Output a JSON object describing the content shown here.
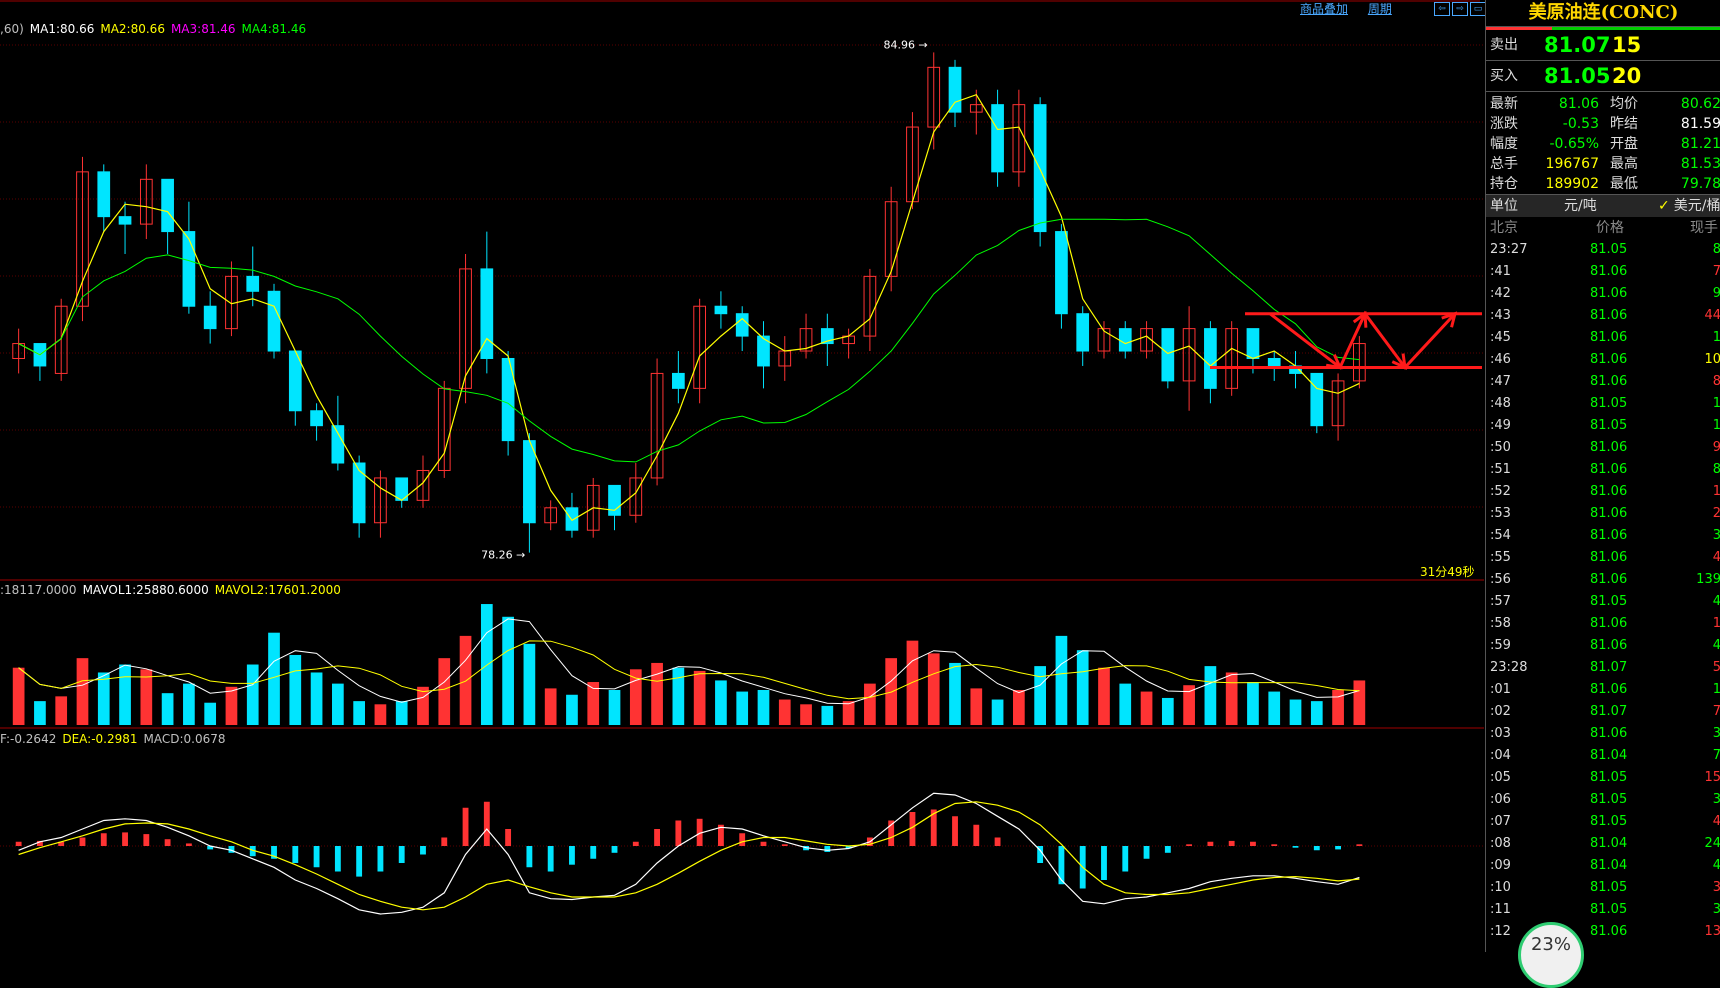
{
  "top_links": {
    "overlay": "商品叠加",
    "period": "周期"
  },
  "legend_main": {
    "prefix": ",60)",
    "ma1": "MA1:80.66",
    "ma2": "MA2:80.66",
    "ma3": "MA3:81.46",
    "ma4": "MA4:81.46"
  },
  "legend_vol": {
    "prefix": ":18117.0000",
    "mavol1": "MAVOL1:25880.6000",
    "mavol2": "MAVOL2:17601.2000"
  },
  "legend_macd": {
    "prefix": "F:-0.2642",
    "dea": "DEA:-0.2981",
    "macd": "MACD:0.0678"
  },
  "countdown": "31分49秒",
  "colors": {
    "up": "#ff3333",
    "down": "#00e5ff",
    "ma1": "#ffffff",
    "ma2": "#ffff00",
    "ma3": "#ff00ff",
    "ma4": "#00ff00",
    "annotation": "#ff1a1a",
    "grid": "#5a0000"
  },
  "chart_data": {
    "type": "candlestick",
    "price_high_label": "84.96",
    "price_low_label": "78.26",
    "ylim": [
      78.0,
      85.3
    ],
    "candles": [
      [
        80.9,
        81.3,
        80.7,
        81.1
      ],
      [
        81.1,
        81.0,
        80.6,
        80.8
      ],
      [
        80.7,
        81.7,
        80.6,
        81.6
      ],
      [
        81.6,
        83.6,
        81.4,
        83.4
      ],
      [
        83.4,
        83.5,
        82.6,
        82.8
      ],
      [
        82.8,
        83.0,
        82.3,
        82.7
      ],
      [
        82.7,
        83.5,
        82.5,
        83.3
      ],
      [
        83.3,
        82.8,
        82.3,
        82.6
      ],
      [
        82.6,
        83.0,
        81.5,
        81.6
      ],
      [
        81.6,
        81.8,
        81.1,
        81.3
      ],
      [
        81.3,
        82.2,
        81.2,
        82.0
      ],
      [
        82.0,
        82.4,
        81.6,
        81.8
      ],
      [
        81.8,
        81.9,
        80.9,
        81.0
      ],
      [
        81.0,
        80.7,
        80.0,
        80.2
      ],
      [
        80.2,
        80.3,
        79.8,
        80.0
      ],
      [
        80.0,
        80.4,
        79.4,
        79.5
      ],
      [
        79.5,
        79.6,
        78.5,
        78.7
      ],
      [
        78.7,
        79.4,
        78.5,
        79.3
      ],
      [
        79.3,
        79.2,
        78.9,
        79.0
      ],
      [
        79.0,
        79.6,
        78.9,
        79.4
      ],
      [
        79.4,
        80.6,
        79.3,
        80.5
      ],
      [
        80.5,
        82.3,
        80.3,
        82.1
      ],
      [
        82.1,
        82.6,
        80.7,
        80.9
      ],
      [
        80.9,
        81.0,
        79.6,
        79.8
      ],
      [
        79.8,
        79.9,
        78.3,
        78.7
      ],
      [
        78.7,
        79.0,
        78.6,
        78.9
      ],
      [
        78.9,
        79.1,
        78.5,
        78.6
      ],
      [
        78.6,
        79.3,
        78.5,
        79.2
      ],
      [
        79.2,
        79.0,
        78.6,
        78.8
      ],
      [
        78.8,
        79.5,
        78.7,
        79.3
      ],
      [
        79.3,
        80.9,
        79.2,
        80.7
      ],
      [
        80.7,
        81.0,
        80.3,
        80.5
      ],
      [
        80.5,
        81.7,
        80.3,
        81.6
      ],
      [
        81.6,
        81.8,
        81.3,
        81.5
      ],
      [
        81.5,
        81.6,
        81.0,
        81.2
      ],
      [
        81.2,
        81.4,
        80.5,
        80.8
      ],
      [
        80.8,
        81.2,
        80.6,
        81.0
      ],
      [
        81.0,
        81.5,
        80.9,
        81.3
      ],
      [
        81.3,
        81.5,
        80.8,
        81.1
      ],
      [
        81.1,
        81.3,
        80.9,
        81.2
      ],
      [
        81.2,
        82.1,
        81.0,
        82.0
      ],
      [
        82.0,
        83.2,
        81.8,
        83.0
      ],
      [
        83.0,
        84.2,
        82.9,
        84.0
      ],
      [
        84.0,
        85.0,
        83.7,
        84.8
      ],
      [
        84.8,
        84.9,
        84.0,
        84.2
      ],
      [
        84.2,
        84.5,
        83.9,
        84.3
      ],
      [
        84.3,
        84.5,
        83.2,
        83.4
      ],
      [
        83.4,
        84.5,
        83.2,
        84.3
      ],
      [
        84.3,
        84.4,
        82.4,
        82.6
      ],
      [
        82.6,
        82.7,
        81.3,
        81.5
      ],
      [
        81.5,
        81.6,
        80.8,
        81.0
      ],
      [
        81.0,
        81.4,
        80.9,
        81.3
      ],
      [
        81.3,
        81.4,
        80.9,
        81.0
      ],
      [
        81.0,
        81.4,
        80.9,
        81.3
      ],
      [
        81.3,
        81.2,
        80.5,
        80.6
      ],
      [
        80.6,
        81.6,
        80.2,
        81.3
      ],
      [
        81.3,
        81.4,
        80.3,
        80.5
      ],
      [
        80.5,
        81.4,
        80.4,
        81.3
      ],
      [
        81.3,
        81.2,
        80.7,
        80.9
      ],
      [
        80.9,
        81.0,
        80.6,
        80.8
      ],
      [
        80.8,
        81.0,
        80.5,
        80.7
      ],
      [
        80.7,
        80.6,
        79.9,
        80.0
      ],
      [
        80.0,
        80.7,
        79.8,
        80.6
      ],
      [
        80.6,
        81.2,
        80.5,
        81.1
      ]
    ],
    "ma_lines": [
      "MA1",
      "MA2",
      "MA3",
      "MA4"
    ],
    "volume": [
      3600,
      1500,
      1800,
      4200,
      3300,
      3800,
      3500,
      2000,
      2600,
      1400,
      2400,
      3800,
      5800,
      4400,
      3300,
      2600,
      1500,
      1300,
      1500,
      2400,
      4200,
      5600,
      7600,
      6800,
      5100,
      2300,
      1900,
      2700,
      2200,
      3500,
      3900,
      3600,
      3400,
      2800,
      2100,
      2200,
      1600,
      1300,
      1200,
      1500,
      2600,
      4200,
      5300,
      4500,
      3900,
      2300,
      1600,
      2200,
      3700,
      5600,
      4700,
      3600,
      2600,
      2100,
      1700,
      2500,
      3700,
      3300,
      2700,
      2100,
      1600,
      1500,
      2200,
      2800
    ],
    "macd_hist": [
      0.05,
      0.06,
      0.05,
      0.1,
      0.15,
      0.16,
      0.14,
      0.08,
      0.03,
      -0.04,
      -0.08,
      -0.12,
      -0.15,
      -0.2,
      -0.25,
      -0.3,
      -0.36,
      -0.3,
      -0.2,
      -0.1,
      0.1,
      0.45,
      0.52,
      0.2,
      -0.25,
      -0.3,
      -0.22,
      -0.15,
      -0.08,
      0.05,
      0.2,
      0.3,
      0.32,
      0.25,
      0.15,
      0.05,
      0.02,
      -0.05,
      -0.07,
      -0.03,
      0.1,
      0.3,
      0.4,
      0.43,
      0.35,
      0.25,
      0.1,
      0.0,
      -0.2,
      -0.45,
      -0.5,
      -0.4,
      -0.3,
      -0.15,
      -0.08,
      0.02,
      0.05,
      0.06,
      0.05,
      0.02,
      -0.02,
      -0.05,
      -0.04,
      0.02
    ],
    "macd_dif": [
      -0.05,
      0.05,
      0.1,
      0.2,
      0.3,
      0.32,
      0.3,
      0.22,
      0.12,
      0.0,
      -0.05,
      -0.15,
      -0.25,
      -0.4,
      -0.5,
      -0.62,
      -0.75,
      -0.8,
      -0.78,
      -0.72,
      -0.55,
      -0.1,
      0.2,
      -0.1,
      -0.55,
      -0.62,
      -0.63,
      -0.6,
      -0.58,
      -0.45,
      -0.2,
      0.0,
      0.15,
      0.22,
      0.2,
      0.12,
      0.05,
      -0.02,
      -0.05,
      -0.03,
      0.05,
      0.25,
      0.45,
      0.62,
      0.6,
      0.5,
      0.35,
      0.2,
      -0.05,
      -0.4,
      -0.65,
      -0.68,
      -0.62,
      -0.6,
      -0.55,
      -0.5,
      -0.42,
      -0.38,
      -0.35,
      -0.35,
      -0.38,
      -0.42,
      -0.45,
      -0.37
    ],
    "macd_dea": [
      -0.1,
      -0.02,
      0.05,
      0.12,
      0.2,
      0.26,
      0.27,
      0.26,
      0.2,
      0.12,
      0.05,
      -0.05,
      -0.12,
      -0.22,
      -0.33,
      -0.45,
      -0.57,
      -0.65,
      -0.72,
      -0.75,
      -0.72,
      -0.6,
      -0.45,
      -0.4,
      -0.48,
      -0.55,
      -0.6,
      -0.6,
      -0.6,
      -0.55,
      -0.45,
      -0.32,
      -0.18,
      -0.05,
      0.05,
      0.1,
      0.1,
      0.06,
      0.02,
      0.0,
      0.02,
      0.1,
      0.22,
      0.38,
      0.5,
      0.52,
      0.48,
      0.4,
      0.25,
      0.02,
      -0.25,
      -0.45,
      -0.55,
      -0.57,
      -0.57,
      -0.55,
      -0.5,
      -0.45,
      -0.4,
      -0.37,
      -0.36,
      -0.38,
      -0.41,
      -0.39
    ],
    "annotation": {
      "upper_line": 81.5,
      "lower_line": 80.78
    }
  },
  "panel": {
    "title": "美原油连(CONC)",
    "sell_label": "卖出",
    "sell_price": "81.07",
    "sell_vol": "15",
    "buy_label": "买入",
    "buy_price": "81.05",
    "buy_vol": "20",
    "stats": [
      {
        "l1": "最新",
        "v1": "81.06",
        "c1": "#00ff00",
        "l2": "均价",
        "v2": "80.62",
        "c2": "#00ff00"
      },
      {
        "l1": "涨跌",
        "v1": "-0.53",
        "c1": "#00ff00",
        "l2": "昨结",
        "v2": "81.59",
        "c2": "#ffffff"
      },
      {
        "l1": "幅度",
        "v1": "-0.65%",
        "c1": "#00ff00",
        "l2": "开盘",
        "v2": "81.21",
        "c2": "#00ff00"
      },
      {
        "l1": "总手",
        "v1": "196767",
        "c1": "#ffff00",
        "l2": "最高",
        "v2": "81.53",
        "c2": "#00ff00"
      },
      {
        "l1": "持仓",
        "v1": "189902",
        "c1": "#ffff00",
        "l2": "最低",
        "v2": "79.78",
        "c2": "#00ff00"
      }
    ],
    "unit_label": "单位",
    "unit_value": "元/吨",
    "unit_alt": "美元/桶",
    "tick_headers": [
      "北京",
      "价格",
      "现手"
    ],
    "ticks": [
      {
        "t": "23:27",
        "p": "81.05",
        "v": "8",
        "vc": "#00ff00"
      },
      {
        "t": ":41",
        "p": "81.06",
        "v": "7",
        "vc": "#ff3333"
      },
      {
        "t": ":42",
        "p": "81.06",
        "v": "9",
        "vc": "#00ff00"
      },
      {
        "t": ":43",
        "p": "81.06",
        "v": "44",
        "vc": "#ff3333"
      },
      {
        "t": ":45",
        "p": "81.06",
        "v": "1",
        "vc": "#00ff00"
      },
      {
        "t": ":46",
        "p": "81.06",
        "v": "10",
        "vc": "#ffff00"
      },
      {
        "t": ":47",
        "p": "81.06",
        "v": "8",
        "vc": "#ff3333"
      },
      {
        "t": ":48",
        "p": "81.05",
        "v": "1",
        "vc": "#00ff00"
      },
      {
        "t": ":49",
        "p": "81.05",
        "v": "1",
        "vc": "#00ff00"
      },
      {
        "t": ":50",
        "p": "81.06",
        "v": "9",
        "vc": "#ff3333"
      },
      {
        "t": ":51",
        "p": "81.06",
        "v": "8",
        "vc": "#00ff00"
      },
      {
        "t": ":52",
        "p": "81.06",
        "v": "1",
        "vc": "#ff3333"
      },
      {
        "t": ":53",
        "p": "81.06",
        "v": "2",
        "vc": "#ff3333"
      },
      {
        "t": ":54",
        "p": "81.06",
        "v": "3",
        "vc": "#00ff00"
      },
      {
        "t": ":55",
        "p": "81.06",
        "v": "4",
        "vc": "#ff3333"
      },
      {
        "t": ":56",
        "p": "81.06",
        "v": "139",
        "vc": "#00ff00"
      },
      {
        "t": ":57",
        "p": "81.05",
        "v": "4",
        "vc": "#00ff00"
      },
      {
        "t": ":58",
        "p": "81.06",
        "v": "1",
        "vc": "#ff3333"
      },
      {
        "t": ":59",
        "p": "81.06",
        "v": "4",
        "vc": "#00ff00"
      },
      {
        "t": "23:28",
        "p": "81.07",
        "v": "5",
        "vc": "#ff3333"
      },
      {
        "t": ":01",
        "p": "81.06",
        "v": "1",
        "vc": "#00ff00"
      },
      {
        "t": ":02",
        "p": "81.07",
        "v": "7",
        "vc": "#ff3333"
      },
      {
        "t": ":03",
        "p": "81.06",
        "v": "3",
        "vc": "#00ff00"
      },
      {
        "t": ":04",
        "p": "81.04",
        "v": "7",
        "vc": "#00ff00"
      },
      {
        "t": ":05",
        "p": "81.05",
        "v": "15",
        "vc": "#ff3333"
      },
      {
        "t": ":06",
        "p": "81.05",
        "v": "3",
        "vc": "#00ff00"
      },
      {
        "t": ":07",
        "p": "81.05",
        "v": "4",
        "vc": "#ff3333"
      },
      {
        "t": ":08",
        "p": "81.04",
        "v": "24",
        "vc": "#00ff00"
      },
      {
        "t": ":09",
        "p": "81.04",
        "v": "4",
        "vc": "#00ff00"
      },
      {
        "t": ":10",
        "p": "81.05",
        "v": "3",
        "vc": "#ff3333"
      },
      {
        "t": ":11",
        "p": "81.05",
        "v": "3",
        "vc": "#00ff00"
      },
      {
        "t": ":12",
        "p": "81.06",
        "v": "13",
        "vc": "#ff3333"
      }
    ],
    "timer_text": "23%"
  }
}
